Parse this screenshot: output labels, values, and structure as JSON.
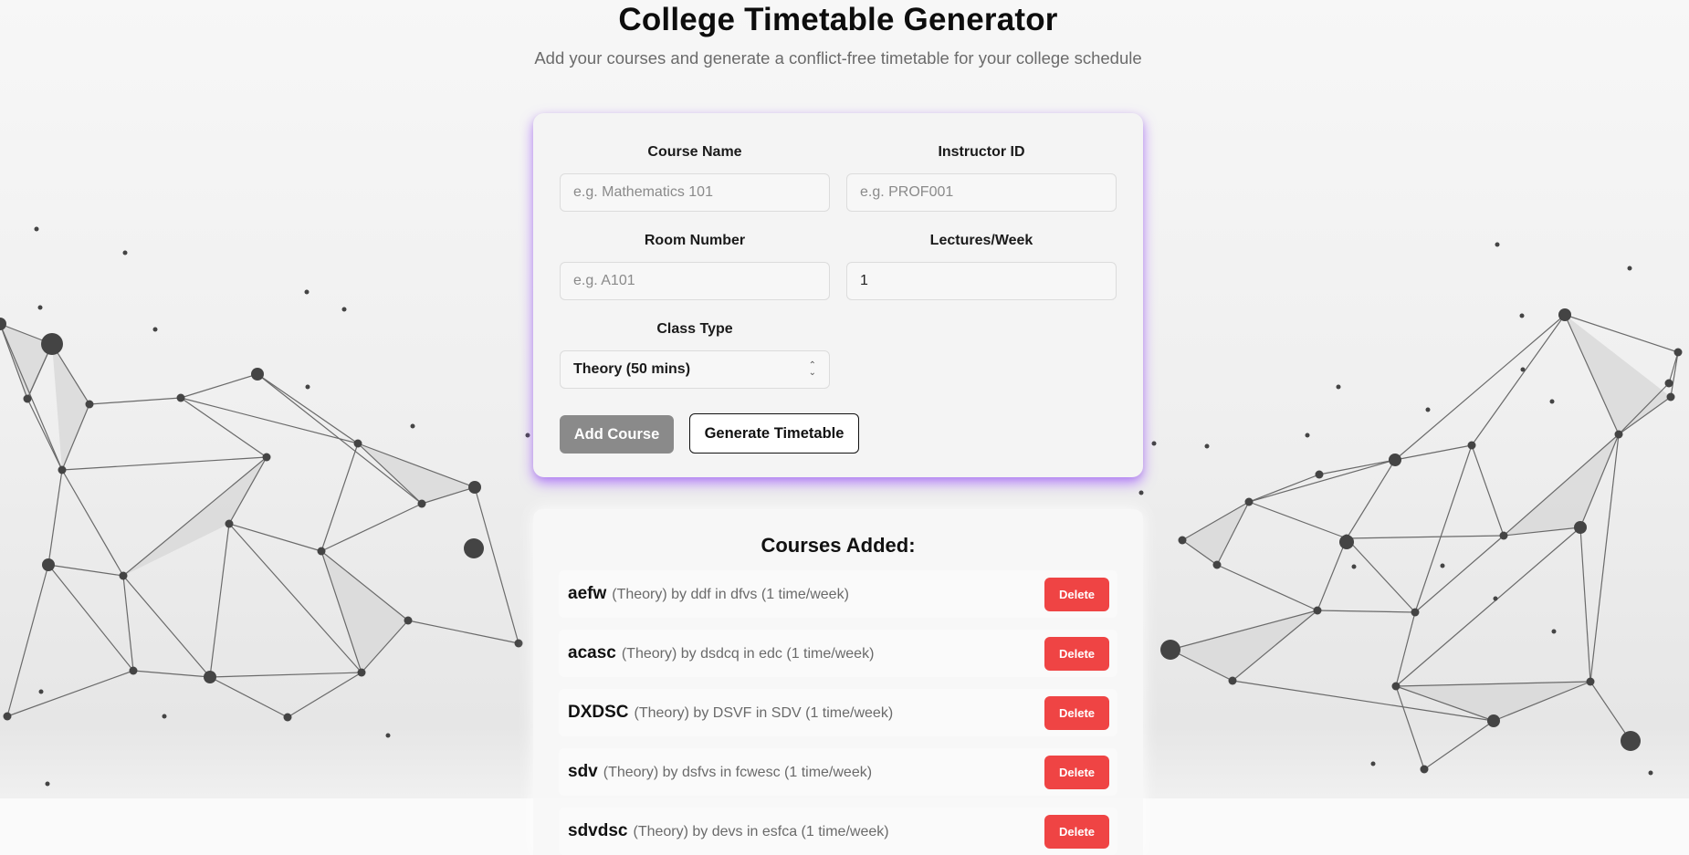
{
  "header": {
    "title": "College Timetable Generator",
    "subtitle": "Add your courses and generate a conflict-free timetable for your college schedule"
  },
  "form": {
    "course_name": {
      "label": "Course Name",
      "placeholder": "e.g. Mathematics 101",
      "value": ""
    },
    "instructor_id": {
      "label": "Instructor ID",
      "placeholder": "e.g. PROF001",
      "value": ""
    },
    "room_number": {
      "label": "Room Number",
      "placeholder": "e.g. A101",
      "value": ""
    },
    "lectures_week": {
      "label": "Lectures/Week",
      "placeholder": "",
      "value": "1"
    },
    "class_type": {
      "label": "Class Type",
      "selected": "Theory (50 mins)"
    },
    "add_label": "Add Course",
    "generate_label": "Generate Timetable"
  },
  "courses": {
    "title": "Courses Added:",
    "delete_label": "Delete",
    "items": [
      {
        "name": "aefw",
        "detail": "(Theory) by ddf in dfvs (1 time/week)"
      },
      {
        "name": "acasc",
        "detail": "(Theory) by dsdcq in edc (1 time/week)"
      },
      {
        "name": "DXDSC",
        "detail": "(Theory) by DSVF in SDV (1 time/week)"
      },
      {
        "name": "sdv",
        "detail": "(Theory) by dsfvs in fcwesc (1 time/week)"
      },
      {
        "name": "sdvdsc",
        "detail": "(Theory) by devs in esfca (1 time/week)"
      }
    ]
  },
  "colors": {
    "accent_glow": "#a05aff",
    "add_button": "#8a8a8a",
    "delete_button": "#ef4444"
  }
}
